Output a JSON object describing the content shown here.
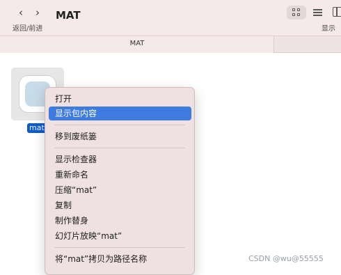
{
  "toolbar": {
    "nav_label": "返回/前进",
    "title": "MAT",
    "show_label": "显示"
  },
  "tabs": [
    {
      "label": "MAT",
      "active": true
    }
  ],
  "file": {
    "name": "mat",
    "selected_color": "#0a5ad6"
  },
  "context_menu": {
    "items": [
      {
        "label": "打开"
      },
      {
        "label": "显示包内容",
        "highlighted": true
      },
      {
        "label": "移到废纸篓"
      },
      {
        "label": "显示检查器"
      },
      {
        "label": "重新命名"
      },
      {
        "label": "压缩“mat”"
      },
      {
        "label": "复制"
      },
      {
        "label": "制作替身"
      },
      {
        "label": "幻灯片放映“mat”"
      },
      {
        "label": "将“mat”拷贝为路径名称"
      }
    ],
    "highlight_color": "#3d7be0"
  },
  "watermark": "CSDN @wu@55555",
  "icons": {
    "back": "chevron-left-icon",
    "forward": "chevron-right-icon",
    "grid_view": "grid-view-icon",
    "list_view": "list-view-icon",
    "column_view": "column-view-icon"
  }
}
